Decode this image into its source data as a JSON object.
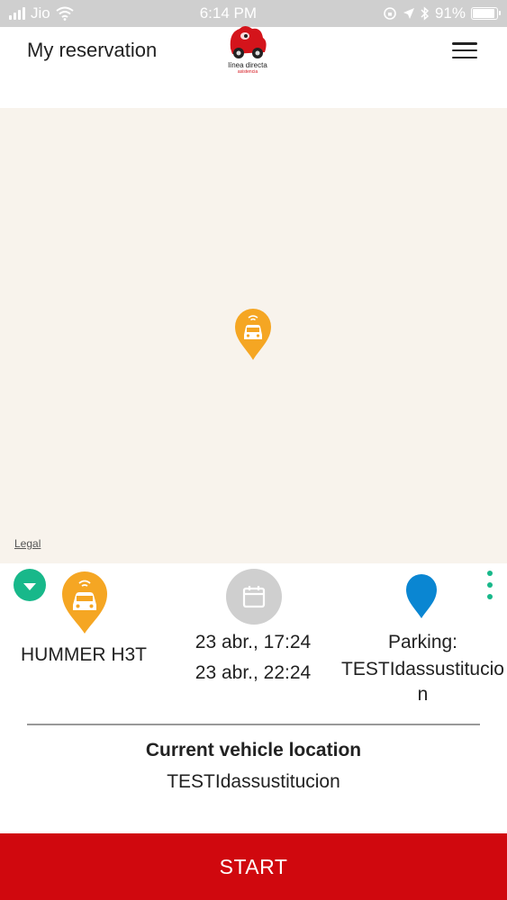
{
  "status_bar": {
    "carrier": "Jio",
    "time": "6:14 PM",
    "battery": "91%",
    "battery_level": 0.91
  },
  "header": {
    "title": "My reservation",
    "logo_text": "línea directa",
    "logo_subtext": "asistencia"
  },
  "map": {
    "legal_label": "Legal"
  },
  "reservation": {
    "vehicle_name": "HUMMER H3T",
    "start_datetime": "23 abr., 17:24",
    "end_datetime": "23 abr., 22:24",
    "parking_label": "Parking:",
    "parking_name": "TESTIdassustitucion"
  },
  "location": {
    "title": "Current vehicle location",
    "value": "TESTIdassustitucion"
  },
  "actions": {
    "start_label": "START"
  },
  "colors": {
    "brand_red": "#d0080e",
    "accent_green": "#18b88a",
    "car_pin_orange": "#f5a623",
    "parking_pin_blue": "#0a86d2",
    "map_background": "#f8f3ec"
  }
}
